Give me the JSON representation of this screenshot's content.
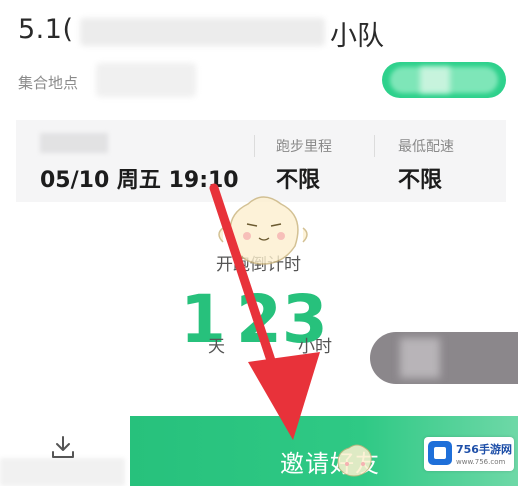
{
  "header": {
    "title_prefix": "5.1(",
    "title_suffix": "小队"
  },
  "venue": {
    "label": "集合地点"
  },
  "info_card": {
    "date_value": "05/10 周五 19:10",
    "distance_label": "跑步里程",
    "distance_value": "不限",
    "pace_label": "最低配速",
    "pace_value": "不限"
  },
  "countdown": {
    "label": "开跑倒计时",
    "days": "1",
    "days_unit": "天",
    "hours": "23",
    "hours_unit": "小时"
  },
  "footer": {
    "invite_label": "邀请好友"
  },
  "watermark": {
    "brand": "756手游网",
    "url": "www.756.com"
  },
  "colors": {
    "accent": "#27c17c",
    "annotation_arrow": "#e8323a"
  },
  "icons": {
    "download": "download-icon",
    "mascot": "cartoon-mascot"
  }
}
